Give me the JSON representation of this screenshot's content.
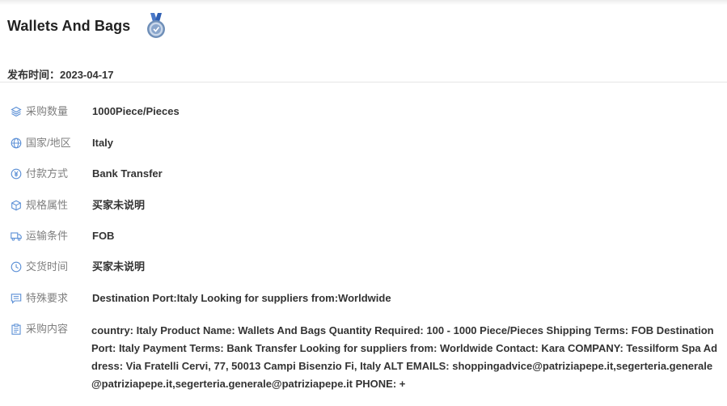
{
  "title": "Wallets And Bags",
  "badge_icon": "medal-icon",
  "publish": {
    "label": "发布时间：",
    "date": "2023-04-17"
  },
  "accent_color": "#5b8fd6",
  "fields": [
    {
      "icon": "layers-icon",
      "label": "采购数量",
      "value": "1000Piece/Pieces"
    },
    {
      "icon": "globe-icon",
      "label": "国家/地区",
      "value": "Italy"
    },
    {
      "icon": "yuan-coin-icon",
      "label": "付款方式",
      "value": "Bank Transfer"
    },
    {
      "icon": "box-icon",
      "label": "规格属性",
      "value": "买家未说明"
    },
    {
      "icon": "truck-icon",
      "label": "运输条件",
      "value": "FOB"
    },
    {
      "icon": "clock-icon",
      "label": "交货时间",
      "value": "买家未说明"
    },
    {
      "icon": "message-icon",
      "label": "特殊要求",
      "value": "Destination Port:Italy Looking for suppliers from:Worldwide"
    },
    {
      "icon": "clipboard-icon",
      "label": "采购内容",
      "value": "country: Italy Product Name: Wallets And Bags Quantity Required: 100 - 1000 Piece/Pieces Shipping Terms: FOB Destination Port: Italy Payment Terms: Bank Transfer Looking for suppliers from: Worldwide Contact: Kara COMPANY: Tessilform Spa Address: Via Fratelli Cervi, 77, 50013 Campi Bisenzio Fi, Italy ALT EMAILS: shoppingadvice@patriziapepe.it,segerteria.generale@patriziapepe.it,segerteria.generale@patriziapepe.it PHONE: +"
    }
  ]
}
